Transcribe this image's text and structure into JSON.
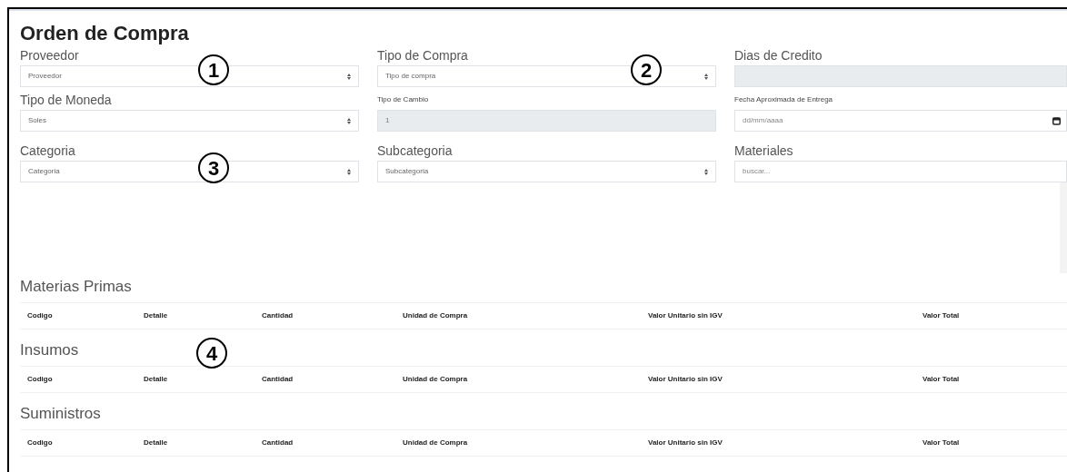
{
  "title": "Orden de Compra",
  "fields": [
    {
      "label": {
        "text": "Proveedor",
        "kind": "heading"
      },
      "kind": "select",
      "value": "Proveedor",
      "disabled": false
    },
    {
      "label": {
        "text": "Tipo de Compra",
        "kind": "heading"
      },
      "kind": "select",
      "value": "Tipo de compra",
      "disabled": false
    },
    {
      "label": {
        "text": "Dias de Credito",
        "kind": "heading"
      },
      "kind": "input",
      "disabled": true
    },
    {
      "label": {
        "text": "Tipo de Moneda",
        "kind": "heading"
      },
      "kind": "select",
      "value": "Soles",
      "disabled": false
    },
    {
      "label": {
        "text": "Tipo de Cambio",
        "kind": "caption"
      },
      "kind": "input",
      "value": "1",
      "disabled": true
    },
    {
      "label": {
        "text": "Fecha Aproximada de Entrega",
        "kind": "caption"
      },
      "kind": "date",
      "placeholder": "dd/mm/aaaa",
      "disabled": false
    },
    {
      "label": {
        "text": "Categoria",
        "kind": "heading"
      },
      "kind": "select",
      "value": "Categoria",
      "disabled": false
    },
    {
      "label": {
        "text": "Subcategoria",
        "kind": "heading"
      },
      "kind": "select",
      "value": "Subcategoria",
      "disabled": false
    },
    {
      "label": {
        "text": "Materiales",
        "kind": "heading"
      },
      "kind": "search",
      "placeholder": "buscar...",
      "disabled": false
    }
  ],
  "sections": [
    {
      "title": "Materias Primas",
      "columns": [
        "Codigo",
        "Detalle",
        "Cantidad",
        "Unidad de Compra",
        "Valor Unitario sin IGV",
        "Valor Total"
      ]
    },
    {
      "title": "Insumos",
      "columns": [
        "Codigo",
        "Detalle",
        "Cantidad",
        "Unidad de Compra",
        "Valor Unitario sin IGV",
        "Valor Total"
      ]
    },
    {
      "title": "Suministros",
      "columns": [
        "Codigo",
        "Detalle",
        "Cantidad",
        "Unidad de Compra",
        "Valor Unitario sin IGV",
        "Valor Total"
      ]
    }
  ],
  "annotations": [
    "1",
    "2",
    "3",
    "4"
  ]
}
